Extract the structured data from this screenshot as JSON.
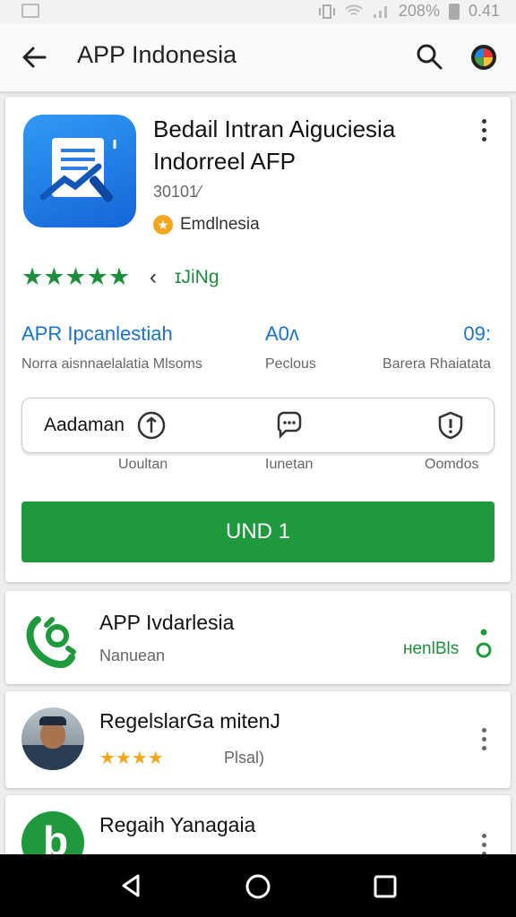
{
  "status_bar": {
    "battery": "208%",
    "time": "0.41"
  },
  "app_bar": {
    "title": "APP Indonesia"
  },
  "app": {
    "name": "Bedail Intran Aiguciesia Indorreel AFP",
    "meta": "30101⁄",
    "developer": "Emdlnesia",
    "rating_stars": "★★★★★",
    "rating_count": "ɪJiNg"
  },
  "stats": [
    {
      "value": "APR Ipcanlestiah",
      "label": "Norra aisnnaelalatia Mlsoms"
    },
    {
      "value": "A0ʌ",
      "label": "Peclous"
    },
    {
      "value": "09:",
      "label": "Barera Rhaiatata"
    }
  ],
  "actions": {
    "primary_label": "Aadaman",
    "labels": [
      "Uoultan",
      "Iunetan",
      "Oomdos"
    ]
  },
  "install_button": "UND 1",
  "list": [
    {
      "title": "APP Ivdarlesia",
      "subtitle": "Nanuean",
      "tag": "ʜenlBls"
    },
    {
      "title": "RegelslarGa mitenJ",
      "stars": "★★★★",
      "subtitle": "Plsal)"
    },
    {
      "title": "Regaih Yanagaia"
    }
  ],
  "colors": {
    "accent_green": "#1e9a3c",
    "accent_blue": "#1a73c8",
    "star_yellow": "#f4a61d"
  }
}
